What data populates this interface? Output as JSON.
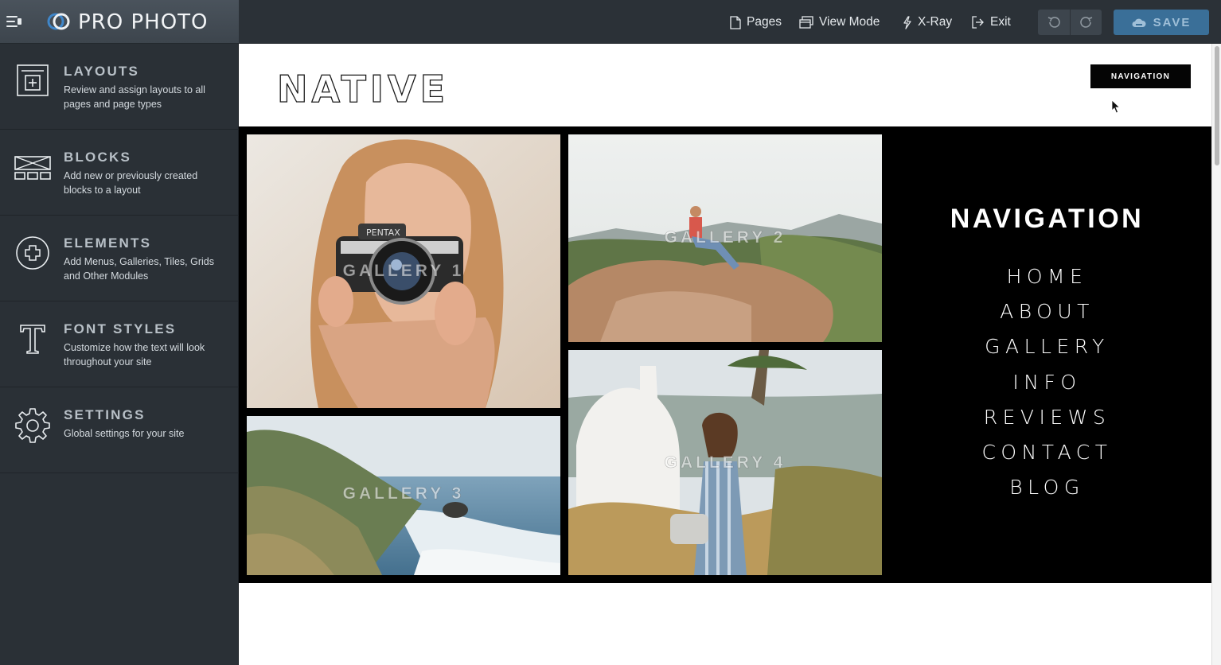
{
  "app": {
    "brand": "PRO PHOTO"
  },
  "sidebar": {
    "items": [
      {
        "title": "LAYOUTS",
        "description": "Review and assign layouts to all pages and page types",
        "icon": "layouts-icon"
      },
      {
        "title": "BLOCKS",
        "description": "Add new or previously created blocks to a layout",
        "icon": "blocks-icon"
      },
      {
        "title": "ELEMENTS",
        "description": "Add Menus, Galleries, Tiles, Grids and Other Modules",
        "icon": "elements-plus-icon"
      },
      {
        "title": "FONT STYLES",
        "description": "Customize how the text will look throughout your site",
        "icon": "font-t-icon"
      },
      {
        "title": "SETTINGS",
        "description": "Global settings for your site",
        "icon": "gear-icon"
      }
    ]
  },
  "toolbar": {
    "pages": "Pages",
    "view_mode": "View Mode",
    "xray": "X-Ray",
    "exit": "Exit",
    "save": "SAVE"
  },
  "site": {
    "logo": "NATIVE",
    "nav_button": "NAVIGATION",
    "galleries": [
      "GALLERY 1",
      "GALLERY 2",
      "GALLERY 3",
      "GALLERY 4"
    ],
    "nav_heading": "NAVIGATION",
    "nav_items": [
      "HOME",
      "ABOUT",
      "GALLERY",
      "INFO",
      "REVIEWS",
      "CONTACT",
      "BLOG"
    ]
  },
  "colors": {
    "sidebar_bg": "#2a3036",
    "save_bg": "#3a6f98",
    "brand_accent": "#3f86c9"
  }
}
